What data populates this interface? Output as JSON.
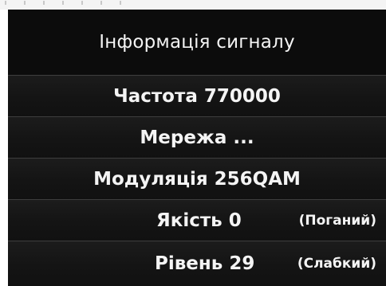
{
  "screen": {
    "title": "Інформація сигналу",
    "frequency": "Частота 770000",
    "network": "Мережа ...",
    "modulation": "Модуляція 256QAM",
    "quality": {
      "label": "Якість 0",
      "status": "(Поганий)"
    },
    "level": {
      "label": "Рівень 29",
      "status": "(Слабкий)"
    }
  }
}
